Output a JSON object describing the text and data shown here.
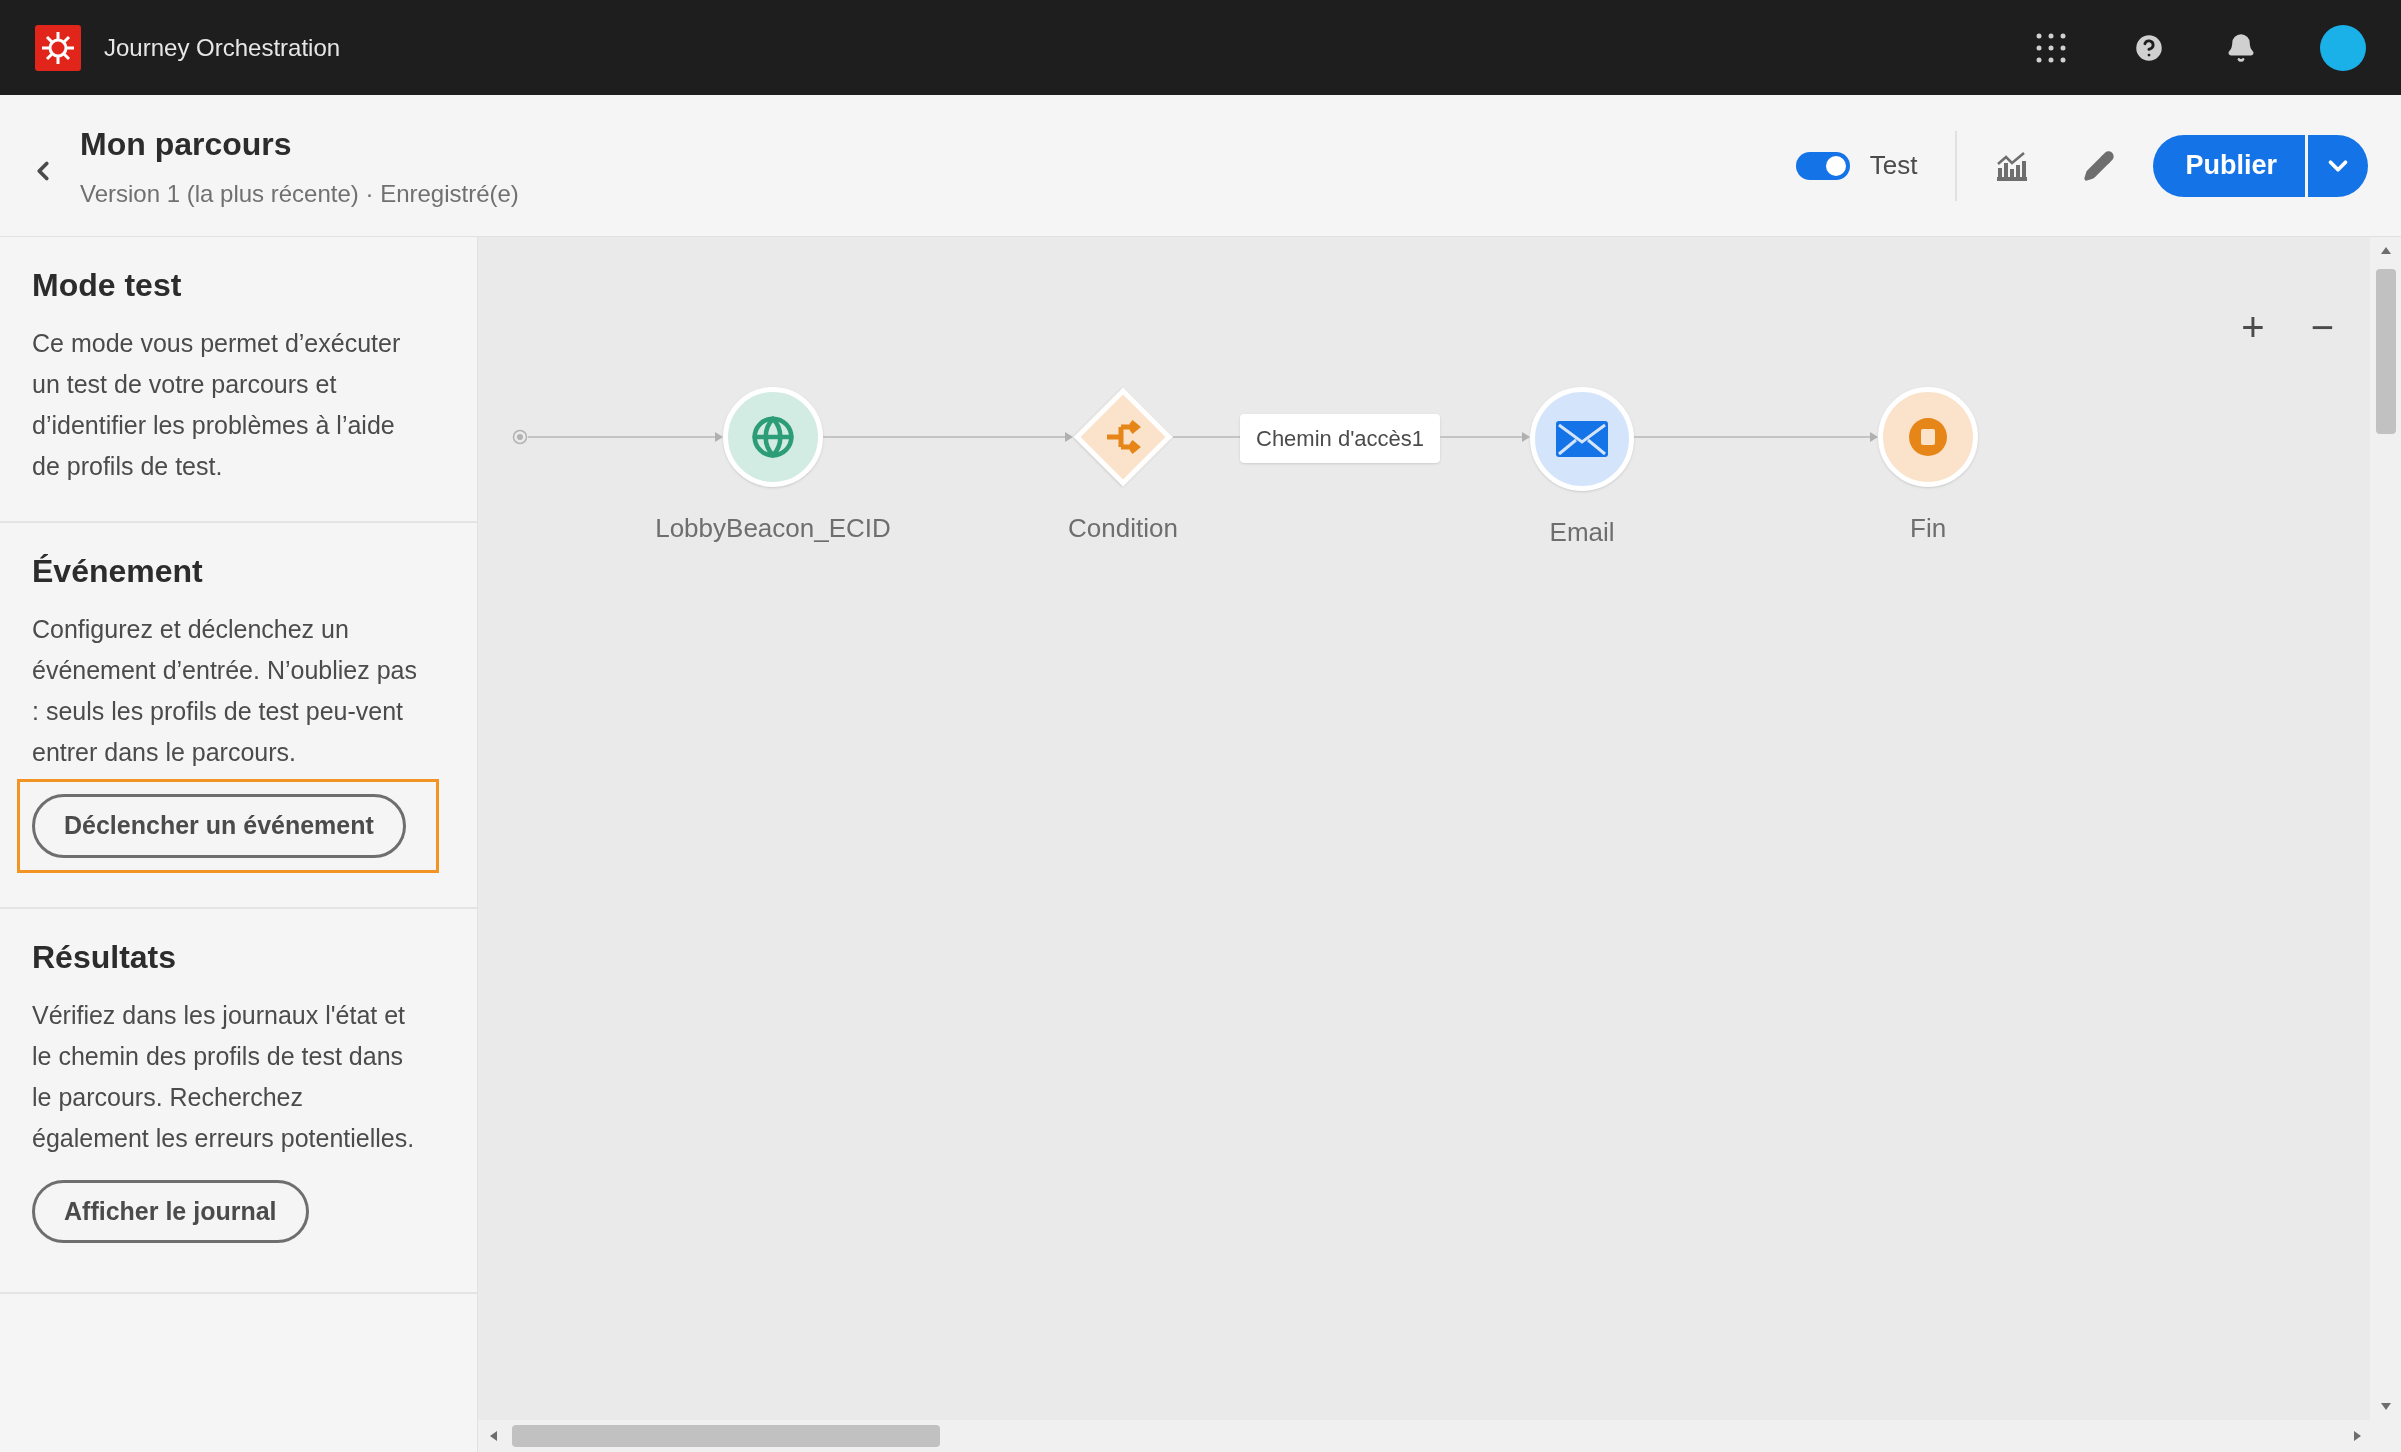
{
  "app": {
    "name": "Journey Orchestration"
  },
  "header": {
    "title": "Mon parcours",
    "subtitle": "Version 1 (la plus récente) · Enregistré(e)",
    "test_toggle": {
      "label": "Test",
      "on": true
    },
    "publish_button": "Publier"
  },
  "panel": {
    "sections": [
      {
        "title": "Mode test",
        "text": "Ce mode vous permet d’exécuter un test de votre parcours et d’identifier les problèmes à l’aide de profils de test."
      },
      {
        "title": "Événement",
        "text": "Configurez et déclenchez un événement d’entrée. N’oubliez pas : seuls les profils de test peu-vent entrer dans le parcours.",
        "button": {
          "label": "Déclencher un événement",
          "highlighted": true
        }
      },
      {
        "title": "Résultats",
        "text": "Vérifiez dans les journaux l'état et le chemin des profils de test dans le parcours. Recherchez également les erreurs potentielles.",
        "button": {
          "label": "Afficher le journal",
          "highlighted": false
        }
      }
    ]
  },
  "canvas": {
    "zoom_in": "+",
    "zoom_out": "−",
    "nodes": [
      {
        "kind": "event",
        "label": "LobbyBeacon_ECID"
      },
      {
        "kind": "condition",
        "label": "Condition"
      },
      {
        "kind": "path",
        "label": "Chemin d'accès1"
      },
      {
        "kind": "email",
        "label": "Email"
      },
      {
        "kind": "end",
        "label": "Fin"
      }
    ]
  }
}
